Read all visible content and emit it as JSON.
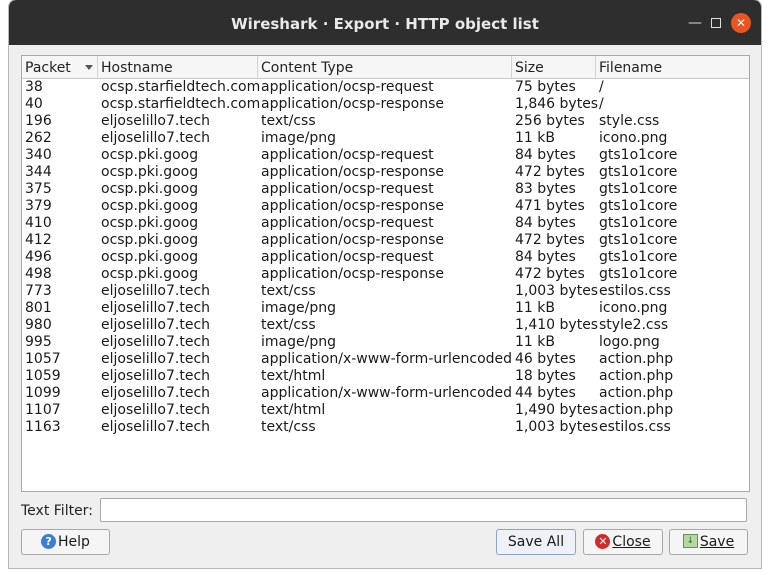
{
  "window": {
    "title": "Wireshark · Export · HTTP object list"
  },
  "columns": {
    "packet": "Packet",
    "hostname": "Hostname",
    "content_type": "Content Type",
    "size": "Size",
    "filename": "Filename"
  },
  "rows": [
    {
      "packet": "38",
      "hostname": "ocsp.starfieldtech.com",
      "content_type": "application/ocsp-request",
      "size": "75 bytes",
      "filename": "/"
    },
    {
      "packet": "40",
      "hostname": "ocsp.starfieldtech.com",
      "content_type": "application/ocsp-response",
      "size": "1,846 bytes",
      "filename": "/"
    },
    {
      "packet": "196",
      "hostname": "eljoselillo7.tech",
      "content_type": "text/css",
      "size": "256 bytes",
      "filename": "style.css"
    },
    {
      "packet": "262",
      "hostname": "eljoselillo7.tech",
      "content_type": "image/png",
      "size": "11 kB",
      "filename": "icono.png"
    },
    {
      "packet": "340",
      "hostname": "ocsp.pki.goog",
      "content_type": "application/ocsp-request",
      "size": "84 bytes",
      "filename": "gts1o1core"
    },
    {
      "packet": "344",
      "hostname": "ocsp.pki.goog",
      "content_type": "application/ocsp-response",
      "size": "472 bytes",
      "filename": "gts1o1core"
    },
    {
      "packet": "375",
      "hostname": "ocsp.pki.goog",
      "content_type": "application/ocsp-request",
      "size": "83 bytes",
      "filename": "gts1o1core"
    },
    {
      "packet": "379",
      "hostname": "ocsp.pki.goog",
      "content_type": "application/ocsp-response",
      "size": "471 bytes",
      "filename": "gts1o1core"
    },
    {
      "packet": "410",
      "hostname": "ocsp.pki.goog",
      "content_type": "application/ocsp-request",
      "size": "84 bytes",
      "filename": "gts1o1core"
    },
    {
      "packet": "412",
      "hostname": "ocsp.pki.goog",
      "content_type": "application/ocsp-response",
      "size": "472 bytes",
      "filename": "gts1o1core"
    },
    {
      "packet": "496",
      "hostname": "ocsp.pki.goog",
      "content_type": "application/ocsp-request",
      "size": "84 bytes",
      "filename": "gts1o1core"
    },
    {
      "packet": "498",
      "hostname": "ocsp.pki.goog",
      "content_type": "application/ocsp-response",
      "size": "472 bytes",
      "filename": "gts1o1core"
    },
    {
      "packet": "773",
      "hostname": "eljoselillo7.tech",
      "content_type": "text/css",
      "size": "1,003 bytes",
      "filename": "estilos.css"
    },
    {
      "packet": "801",
      "hostname": "eljoselillo7.tech",
      "content_type": "image/png",
      "size": "11 kB",
      "filename": "icono.png"
    },
    {
      "packet": "980",
      "hostname": "eljoselillo7.tech",
      "content_type": "text/css",
      "size": "1,410 bytes",
      "filename": "style2.css"
    },
    {
      "packet": "995",
      "hostname": "eljoselillo7.tech",
      "content_type": "image/png",
      "size": "11 kB",
      "filename": "logo.png"
    },
    {
      "packet": "1057",
      "hostname": "eljoselillo7.tech",
      "content_type": "application/x-www-form-urlencoded",
      "size": "46 bytes",
      "filename": "action.php"
    },
    {
      "packet": "1059",
      "hostname": "eljoselillo7.tech",
      "content_type": "text/html",
      "size": "18 bytes",
      "filename": "action.php"
    },
    {
      "packet": "1099",
      "hostname": "eljoselillo7.tech",
      "content_type": "application/x-www-form-urlencoded",
      "size": "44 bytes",
      "filename": "action.php"
    },
    {
      "packet": "1107",
      "hostname": "eljoselillo7.tech",
      "content_type": "text/html",
      "size": "1,490 bytes",
      "filename": "action.php"
    },
    {
      "packet": "1163",
      "hostname": "eljoselillo7.tech",
      "content_type": "text/css",
      "size": "1,003 bytes",
      "filename": "estilos.css"
    }
  ],
  "filter": {
    "label": "Text Filter:",
    "value": ""
  },
  "buttons": {
    "help": {
      "label": "Help",
      "icon": "help-icon"
    },
    "save_all": {
      "label": "Save All"
    },
    "close": {
      "label": "Close",
      "icon": "close-icon"
    },
    "save": {
      "label": "Save",
      "icon": "save-icon"
    }
  },
  "colors": {
    "titlebar": "#2e2e2e",
    "close_button": "#e95420",
    "dialog_bg": "#efefef"
  }
}
